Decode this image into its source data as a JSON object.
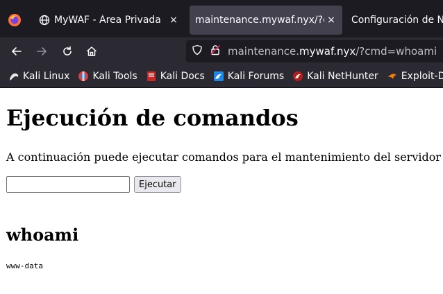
{
  "browser": {
    "tabs": [
      {
        "title": "MyWAF - Área Privada",
        "close": "×"
      },
      {
        "title": "maintenance.mywaf.nyx/?cmd=whoami",
        "close": "×"
      },
      {
        "title": "Configuración de N"
      }
    ],
    "url": {
      "prefix": "maintenance.",
      "host": "mywaf.nyx",
      "path": "/?cmd=whoami"
    },
    "bookmarks": [
      "Kali Linux",
      "Kali Tools",
      "Kali Docs",
      "Kali Forums",
      "Kali NetHunter",
      "Exploit-DB"
    ]
  },
  "page": {
    "heading": "Ejecución de comandos",
    "description": "A continuación puede ejecutar comandos para el mantenimiento del servidor",
    "input_value": "",
    "button_label": "Ejecutar",
    "result_heading": "whoami",
    "result_output": "www-data"
  },
  "colors": {
    "chrome_bg": "#2b2a33",
    "tabbar_bg": "#1c1b22",
    "active_tab": "#42414d"
  }
}
